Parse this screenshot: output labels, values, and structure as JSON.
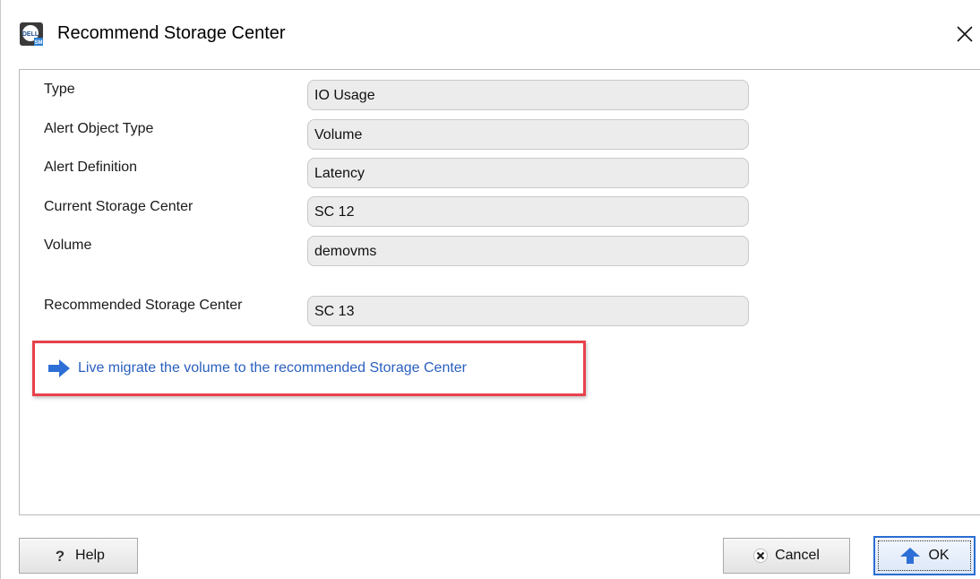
{
  "window": {
    "title": "Recommend Storage Center",
    "icon": "dell-storage-manager-icon",
    "close_icon": "close-icon"
  },
  "details": [
    {
      "label": "Type",
      "value": "IO Usage"
    },
    {
      "label": "Alert Object Type",
      "value": "Volume"
    },
    {
      "label": "Alert Definition",
      "value": "Latency"
    },
    {
      "label": "Current Storage Center",
      "value": "SC 12"
    },
    {
      "label": "Volume",
      "value": "demovms"
    }
  ],
  "recommendation": {
    "label": "Recommended Storage Center",
    "value": "SC 13"
  },
  "action": {
    "label": "Live migrate the volume to the recommended Storage Center",
    "icon": "arrow-right-icon"
  },
  "footer": {
    "help_label": "Help",
    "help_icon": "help-icon",
    "cancel_label": "Cancel",
    "cancel_icon": "cancel-icon",
    "ok_label": "OK",
    "ok_icon": "up-arrow-icon"
  },
  "colors": {
    "link": "#2a5fbf",
    "highlight": "#e8414b",
    "field_bg": "#ececec"
  }
}
